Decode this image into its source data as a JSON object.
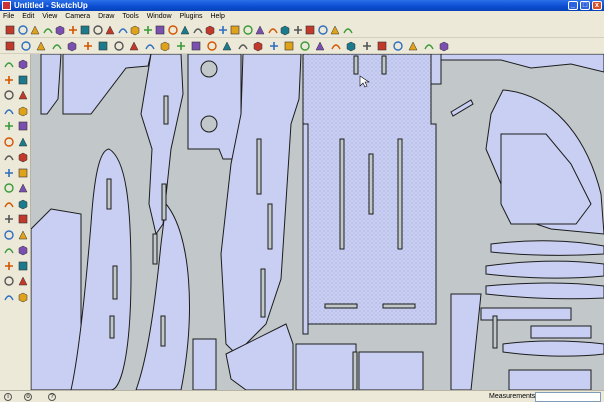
{
  "window": {
    "title": "Untitled - SketchUp"
  },
  "titlebar_buttons": {
    "minimize": "_",
    "maximize": "□",
    "close": "x"
  },
  "menu": [
    "File",
    "Edit",
    "View",
    "Camera",
    "Draw",
    "Tools",
    "Window",
    "Plugins",
    "Help"
  ],
  "toolbar_row1_icons": [
    "new-icon",
    "open-icon",
    "save-icon",
    "cut-icon",
    "copy-icon",
    "paste-icon",
    "erase-icon",
    "undo-icon",
    "redo-icon",
    "print-icon",
    "model-info-icon",
    "select-icon",
    "make-component-icon",
    "paint-bucket-icon",
    "eraser-icon",
    "rectangle-icon",
    "line-icon",
    "circle-icon",
    "arc-icon",
    "polygon-icon",
    "freehand-icon",
    "move-icon",
    "push-pull-icon",
    "rotate-icon",
    "follow-me-icon",
    "scale-icon",
    "offset-icon",
    "tape-measure-icon",
    "dimension-icon",
    "protractor-icon",
    "text-icon",
    "axes-icon",
    "3d-text-icon",
    "orbit-icon",
    "pan-icon",
    "zoom-icon",
    "zoom-window-icon",
    "zoom-extents-icon",
    "previous-icon",
    "next-icon",
    "iso-view-icon",
    "top-view-icon",
    "front-view-icon",
    "right-view-icon",
    "back-view-icon",
    "left-view-icon",
    "xray-icon",
    "wireframe-icon",
    "hidden-line-icon",
    "shaded-icon",
    "shaded-texture-icon",
    "monochrome-icon"
  ],
  "toolbar_row2_icons": [
    "sandbox-from-contours-icon",
    "sandbox-from-scratch-icon",
    "smoove-icon",
    "stamp-icon",
    "drape-icon",
    "add-detail-icon",
    "flip-edge-icon",
    "warehouse-get-icon",
    "share-model-icon",
    "share-component-icon",
    "google-earth-icon",
    "get-current-view-icon",
    "toggle-terrain-icon",
    "place-model-icon",
    "get-photo-texture-icon",
    "solid-outer-shell-icon",
    "intersect-icon",
    "union-icon",
    "subtract-icon",
    "trim-icon",
    "split-icon",
    "section-plane-icon",
    "display-section-planes-icon",
    "display-section-cuts-icon",
    "dynamic-components-icon",
    "interact-icon",
    "component-options-icon",
    "component-attributes-icon",
    "walk-icon",
    "look-around-icon",
    "position-camera-icon",
    "help-icon"
  ],
  "palette_icons": [
    "select-icon",
    "make-component-icon",
    "eraser-icon",
    "paint-bucket-icon",
    "rectangle-icon",
    "line-icon",
    "circle-icon",
    "arc-icon",
    "polygon-icon",
    "freehand-icon",
    "move-icon",
    "push-pull-icon",
    "rotate-icon",
    "follow-me-icon",
    "scale-icon",
    "offset-icon",
    "tape-measure-icon",
    "dimension-icon",
    "protractor-icon",
    "text-icon",
    "axes-icon",
    "3d-text-icon",
    "orbit-icon",
    "pan-icon",
    "zoom-icon",
    "zoom-window-icon",
    "zoom-extents-icon",
    "previous-icon",
    "position-camera-icon",
    "walk-icon",
    "look-around-icon",
    "section-plane-icon"
  ],
  "status": {
    "measurements_label": "Measurements",
    "measurements_value": "",
    "info_icon": "i",
    "user_icon": "o",
    "help_icon": "?"
  },
  "colors": {
    "canvas_bg": "#c2c7c9",
    "part_fill": "#c9cff2",
    "part_stroke": "#1c1c1c",
    "accent": "#0a4cd0"
  }
}
